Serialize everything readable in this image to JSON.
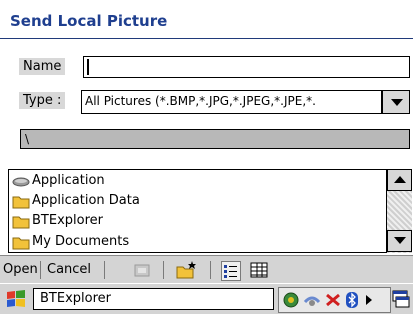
{
  "dialog": {
    "title": "Send Local Picture",
    "name_label": "Name",
    "name_value": "",
    "type_label": "Type :",
    "type_value": "All Pictures (*.BMP,*.JPG,*.JPEG,*.JPE,*.",
    "path_value": "\\"
  },
  "file_list": [
    {
      "name": "Application",
      "icon": "drive-icon"
    },
    {
      "name": "Application Data",
      "icon": "folder-icon"
    },
    {
      "name": "BTExplorer",
      "icon": "folder-icon"
    },
    {
      "name": "My Documents",
      "icon": "folder-icon"
    }
  ],
  "toolbar": {
    "open_label": "Open",
    "cancel_label": "Cancel",
    "icons": [
      "up-folder-icon",
      "new-folder-icon",
      "list-view-icon",
      "details-view-icon"
    ]
  },
  "taskbar": {
    "active_app": "BTExplorer",
    "tray_icons": [
      "network-icon",
      "connection-icon",
      "bluetooth-icon",
      "bluetooth-radio-icon",
      "arrow-icon"
    ]
  },
  "colors": {
    "title": "#1f3f8f",
    "folder": "#f2c23a",
    "chrome": "#d4d4d4"
  }
}
